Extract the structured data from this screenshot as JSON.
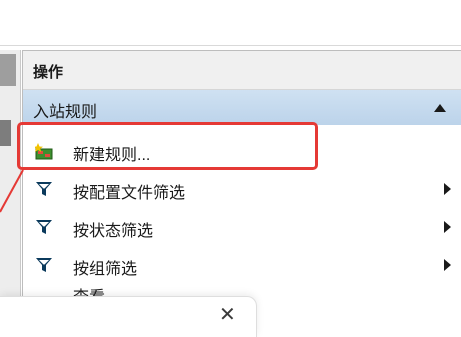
{
  "actions_panel": {
    "title": "操作",
    "section": {
      "label": "入站规则",
      "collapse_icon": "triangle-up-icon"
    },
    "items": [
      {
        "label": "新建规则...",
        "icon": "new-rule-icon",
        "has_submenu": false
      },
      {
        "label": "按配置文件筛选",
        "icon": "filter-icon",
        "has_submenu": true
      },
      {
        "label": "按状态筛选",
        "icon": "filter-icon",
        "has_submenu": true
      },
      {
        "label": "按组筛选",
        "icon": "filter-icon",
        "has_submenu": true
      }
    ],
    "partial_item_label": "查看"
  },
  "dialog": {
    "close_glyph": "✕"
  },
  "colors": {
    "highlight": "#e53935",
    "section_bar": "#c5d9ee",
    "filter_icon": "#0b3a5c"
  }
}
